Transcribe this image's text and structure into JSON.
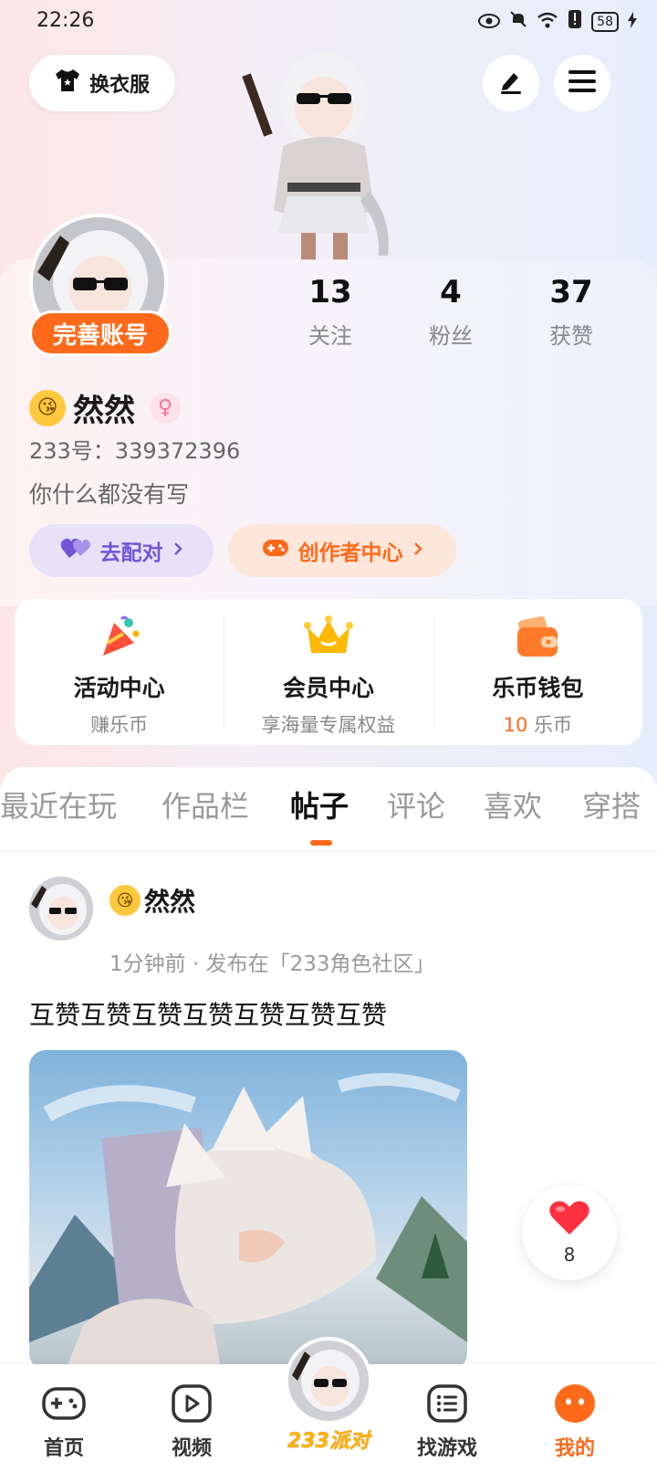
{
  "status_bar": {
    "time": "22:26",
    "battery": "58"
  },
  "header": {
    "dress_label": "换衣服"
  },
  "profile": {
    "complete_label": "完善账号",
    "stats": [
      {
        "num": "13",
        "label": "关注"
      },
      {
        "num": "4",
        "label": "粉丝"
      },
      {
        "num": "37",
        "label": "获赞"
      }
    ],
    "name": "然然",
    "gender_symbol": "♀",
    "uid": "233号：339372396",
    "bio": "你什么都没有写",
    "pair_label": "去配对",
    "creator_label": "创作者中心"
  },
  "quick_links": [
    {
      "title": "活动中心",
      "sub": "赚乐币"
    },
    {
      "title": "会员中心",
      "sub": "享海量专属权益"
    },
    {
      "title": "乐币钱包",
      "sub_value": "10",
      "sub_unit": " 乐币"
    }
  ],
  "tabs": [
    "最近在玩",
    "作品栏",
    "帖子",
    "评论",
    "喜欢",
    "穿搭"
  ],
  "active_tab": "帖子",
  "post": {
    "author": "然然",
    "meta": "1分钟前 · 发布在「233角色社区」",
    "text": "互赞互赞互赞互赞互赞互赞互赞",
    "likes": "8"
  },
  "bottom_nav": {
    "home": "首页",
    "video": "视频",
    "party": "233派对",
    "games": "找游戏",
    "mine": "我的"
  },
  "colors": {
    "accent": "#ff6a1a",
    "purple": "#7255d6"
  }
}
